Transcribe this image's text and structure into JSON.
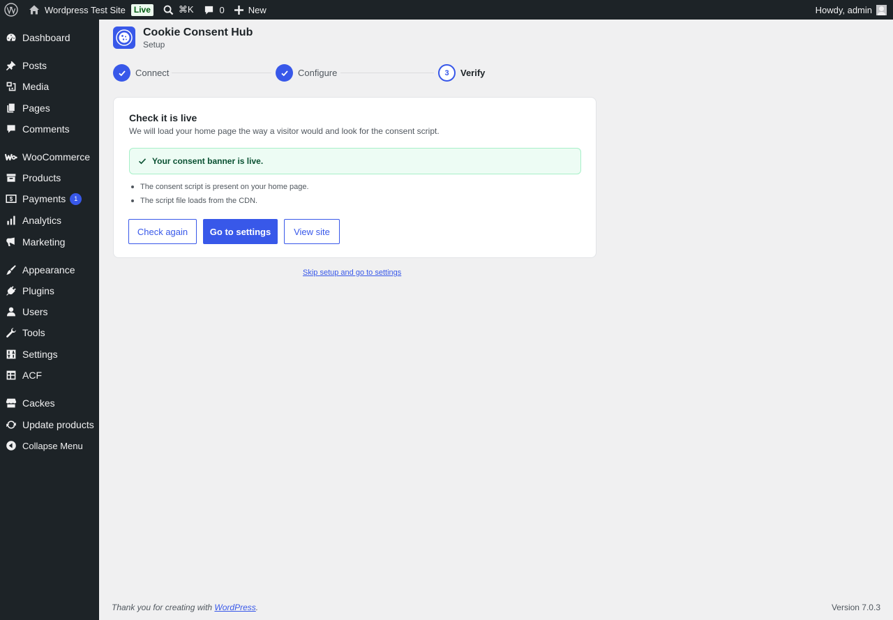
{
  "admin_bar": {
    "site_name": "Wordpress Test Site",
    "live_badge": "Live",
    "search_shortcut": "⌘K",
    "comments_count": "0",
    "new_label": "New",
    "greeting": "Howdy, admin"
  },
  "sidebar": {
    "items": [
      {
        "label": "Dashboard",
        "icon": "dashboard-icon"
      },
      {
        "label": "Posts",
        "icon": "pin-icon"
      },
      {
        "label": "Media",
        "icon": "media-icon"
      },
      {
        "label": "Pages",
        "icon": "pages-icon"
      },
      {
        "label": "Comments",
        "icon": "comment-icon"
      },
      {
        "label": "WooCommerce",
        "icon": "woocommerce-icon"
      },
      {
        "label": "Products",
        "icon": "archive-icon"
      },
      {
        "label": "Payments",
        "icon": "dollar-icon",
        "badge": "1"
      },
      {
        "label": "Analytics",
        "icon": "bar-chart-icon"
      },
      {
        "label": "Marketing",
        "icon": "megaphone-icon"
      },
      {
        "label": "Appearance",
        "icon": "brush-icon"
      },
      {
        "label": "Plugins",
        "icon": "plug-icon"
      },
      {
        "label": "Users",
        "icon": "user-icon"
      },
      {
        "label": "Tools",
        "icon": "wrench-icon"
      },
      {
        "label": "Settings",
        "icon": "sliders-icon"
      },
      {
        "label": "ACF",
        "icon": "grid-table-icon"
      },
      {
        "label": "Cackes",
        "icon": "store-icon"
      },
      {
        "label": "Update products",
        "icon": "refresh-icon"
      }
    ],
    "collapse_label": "Collapse Menu"
  },
  "header": {
    "title": "Cookie Consent Hub",
    "subtitle": "Setup"
  },
  "steps": [
    {
      "label": "Connect",
      "state": "done"
    },
    {
      "label": "Configure",
      "state": "done"
    },
    {
      "label": "Verify",
      "state": "current",
      "number": "3"
    }
  ],
  "card": {
    "title": "Check it is live",
    "description": "We will load your home page the way a visitor would and look for the consent script.",
    "notice": "Your consent banner is live.",
    "checks": [
      "The consent script is present on your home page.",
      "The script file loads from the CDN."
    ],
    "buttons": {
      "check_again": "Check again",
      "go_to_settings": "Go to settings",
      "view_site": "View site"
    }
  },
  "skip_link": "Skip setup and go to settings",
  "footer": {
    "thank_you_prefix": "Thank you for creating with ",
    "wordpress_link": "WordPress",
    "thank_you_suffix": ".",
    "version": "Version 7.0.3"
  },
  "colors": {
    "accent": "#3858e9",
    "admin_dark": "#1d2327",
    "background": "#f0f0f1",
    "success_bg": "#edfcf4",
    "success_text": "#0a5132"
  }
}
